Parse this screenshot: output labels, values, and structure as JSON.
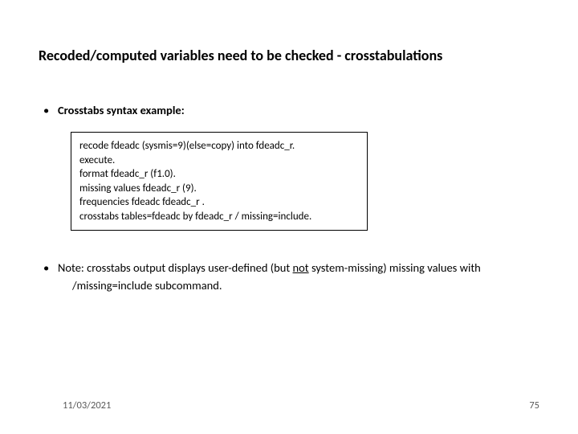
{
  "title": "Recoded/computed variables need to be checked - crosstabulations",
  "bullet1": "Crosstabs syntax example:",
  "code": {
    "l1": "recode fdeadc (sysmis=9)(else=copy) into fdeadc_r.",
    "l2": "execute.",
    "l3": "format fdeadc_r (f1.0).",
    "l4": "missing values fdeadc_r (9).",
    "l5": "frequencies fdeadc fdeadc_r .",
    "l6": "crosstabs tables=fdeadc by fdeadc_r / missing=include."
  },
  "note": {
    "pre": "Note: crosstabs output displays user-defined (but ",
    "underlined": "not",
    "post": " system-missing) missing values with",
    "line2": "/missing=include subcommand."
  },
  "footer": {
    "date": "11/03/2021",
    "pagenum": "75"
  }
}
